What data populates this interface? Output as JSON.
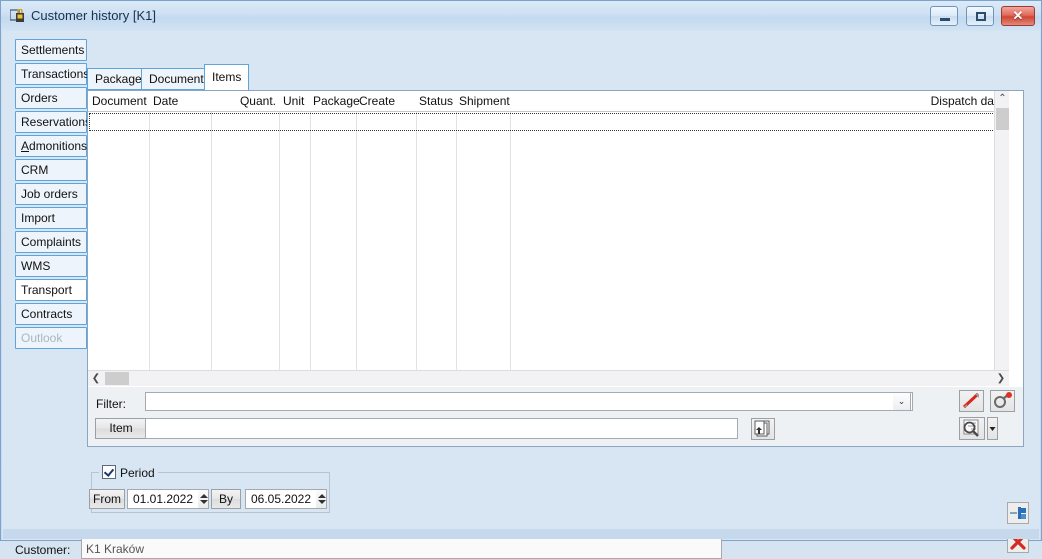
{
  "window": {
    "title": "Customer history [K1]",
    "icon": "window-lock-icon",
    "controls": {
      "minimize": "minimize",
      "maximize": "maximize",
      "close": "close"
    }
  },
  "side_tabs": [
    {
      "label": "Settlements",
      "state": "normal"
    },
    {
      "label": "Transactions",
      "state": "normal"
    },
    {
      "label": "Orders",
      "state": "normal"
    },
    {
      "label": "Reservations",
      "state": "normal"
    },
    {
      "label": "Admonitions",
      "state": "normal",
      "accel": "A"
    },
    {
      "label": "CRM",
      "state": "normal"
    },
    {
      "label": "Job orders",
      "state": "normal"
    },
    {
      "label": "Import",
      "state": "normal"
    },
    {
      "label": "Complaints",
      "state": "normal"
    },
    {
      "label": "WMS",
      "state": "normal"
    },
    {
      "label": "Transport",
      "state": "selected"
    },
    {
      "label": "Contracts",
      "state": "normal"
    },
    {
      "label": "Outlook",
      "state": "disabled"
    }
  ],
  "top_tabs": [
    {
      "label": "Packages",
      "selected": false
    },
    {
      "label": "Documents",
      "selected": false
    },
    {
      "label": "Items",
      "selected": true
    }
  ],
  "grid": {
    "columns": [
      {
        "label": "Document",
        "align": "left"
      },
      {
        "label": "Date",
        "align": "left"
      },
      {
        "label": "Quant.",
        "align": "right"
      },
      {
        "label": "Unit",
        "align": "left"
      },
      {
        "label": "Package",
        "align": "left"
      },
      {
        "label": "Create",
        "align": "left"
      },
      {
        "label": "Status",
        "align": "left"
      },
      {
        "label": "Shipment",
        "align": "left"
      },
      {
        "label": "Dispatch date",
        "align": "right"
      }
    ],
    "rows": []
  },
  "filter_panel": {
    "filter_label": "Filter:",
    "filter_value": "",
    "filter_placeholder": "",
    "item_button": "Item",
    "item_value": "",
    "item_placeholder": "",
    "pick_icon": "copy-documents-icon",
    "clear_filter_icon": "clear-filter-pencil-icon",
    "filter_settings_icon": "filter-key-icon",
    "search_icon": "search-magnifier-icon",
    "search_dropdown_icon": "dropdown-arrow-icon"
  },
  "period": {
    "checkbox_label": "Period",
    "checked": true,
    "from_label": "From",
    "from_value": "01.01.2022",
    "by_label": "By",
    "by_value": "06.05.2022"
  },
  "customer": {
    "label": "Customer:",
    "value": "K1 Kraków"
  },
  "action_buttons": {
    "accept_icon": "save-exit-icon",
    "cancel_icon": "close-red-x-icon"
  },
  "colors": {
    "accent": "#5fa5dc",
    "window_bg": "#d8e5f2",
    "close_red": "#cf4734",
    "icon_red": "#d42a1f",
    "icon_blue": "#2a6fb5"
  }
}
